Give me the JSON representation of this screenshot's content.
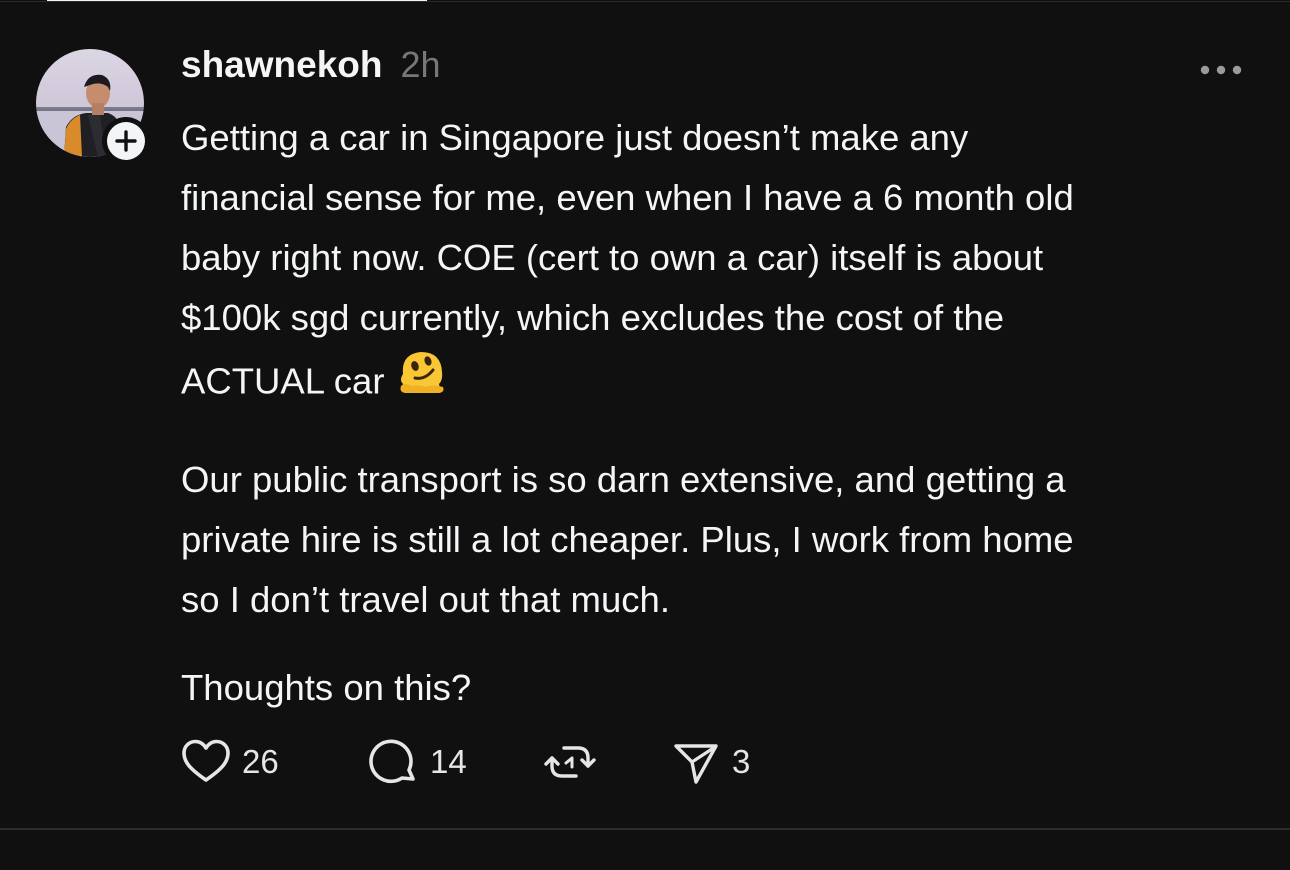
{
  "post": {
    "author": "shawnekoh",
    "time": "2h",
    "paragraphs": [
      {
        "lines": [
          "Getting a car in Singapore just doesn’t make any",
          "financial sense for me, even when I have a 6 month old",
          "baby right now. COE (cert to own a car) itself is about",
          "$100k sgd currently, which excludes the cost of the",
          "ACTUAL car"
        ],
        "trailing_emoji": "melting-face-emoji"
      },
      {
        "lines": [
          "Our public transport is so darn extensive, and getting a",
          "private hire is still a lot cheaper. Plus, I work from home",
          "so I don’t travel out that much."
        ]
      },
      {
        "lines": [
          "Thoughts on this?"
        ]
      }
    ],
    "actions": {
      "likes": "26",
      "replies": "14",
      "shares": "3"
    }
  },
  "icons": {
    "avatar": "profile-photo",
    "follow": "plus-icon",
    "more": "ellipsis-icon",
    "like": "heart-icon",
    "reply": "comment-bubble-icon",
    "repost": "repost-icon",
    "share": "send-icon"
  },
  "colors": {
    "background": "#101010",
    "text": "#f3f5f7",
    "muted": "#777777",
    "divider": "#2c2c2c"
  }
}
